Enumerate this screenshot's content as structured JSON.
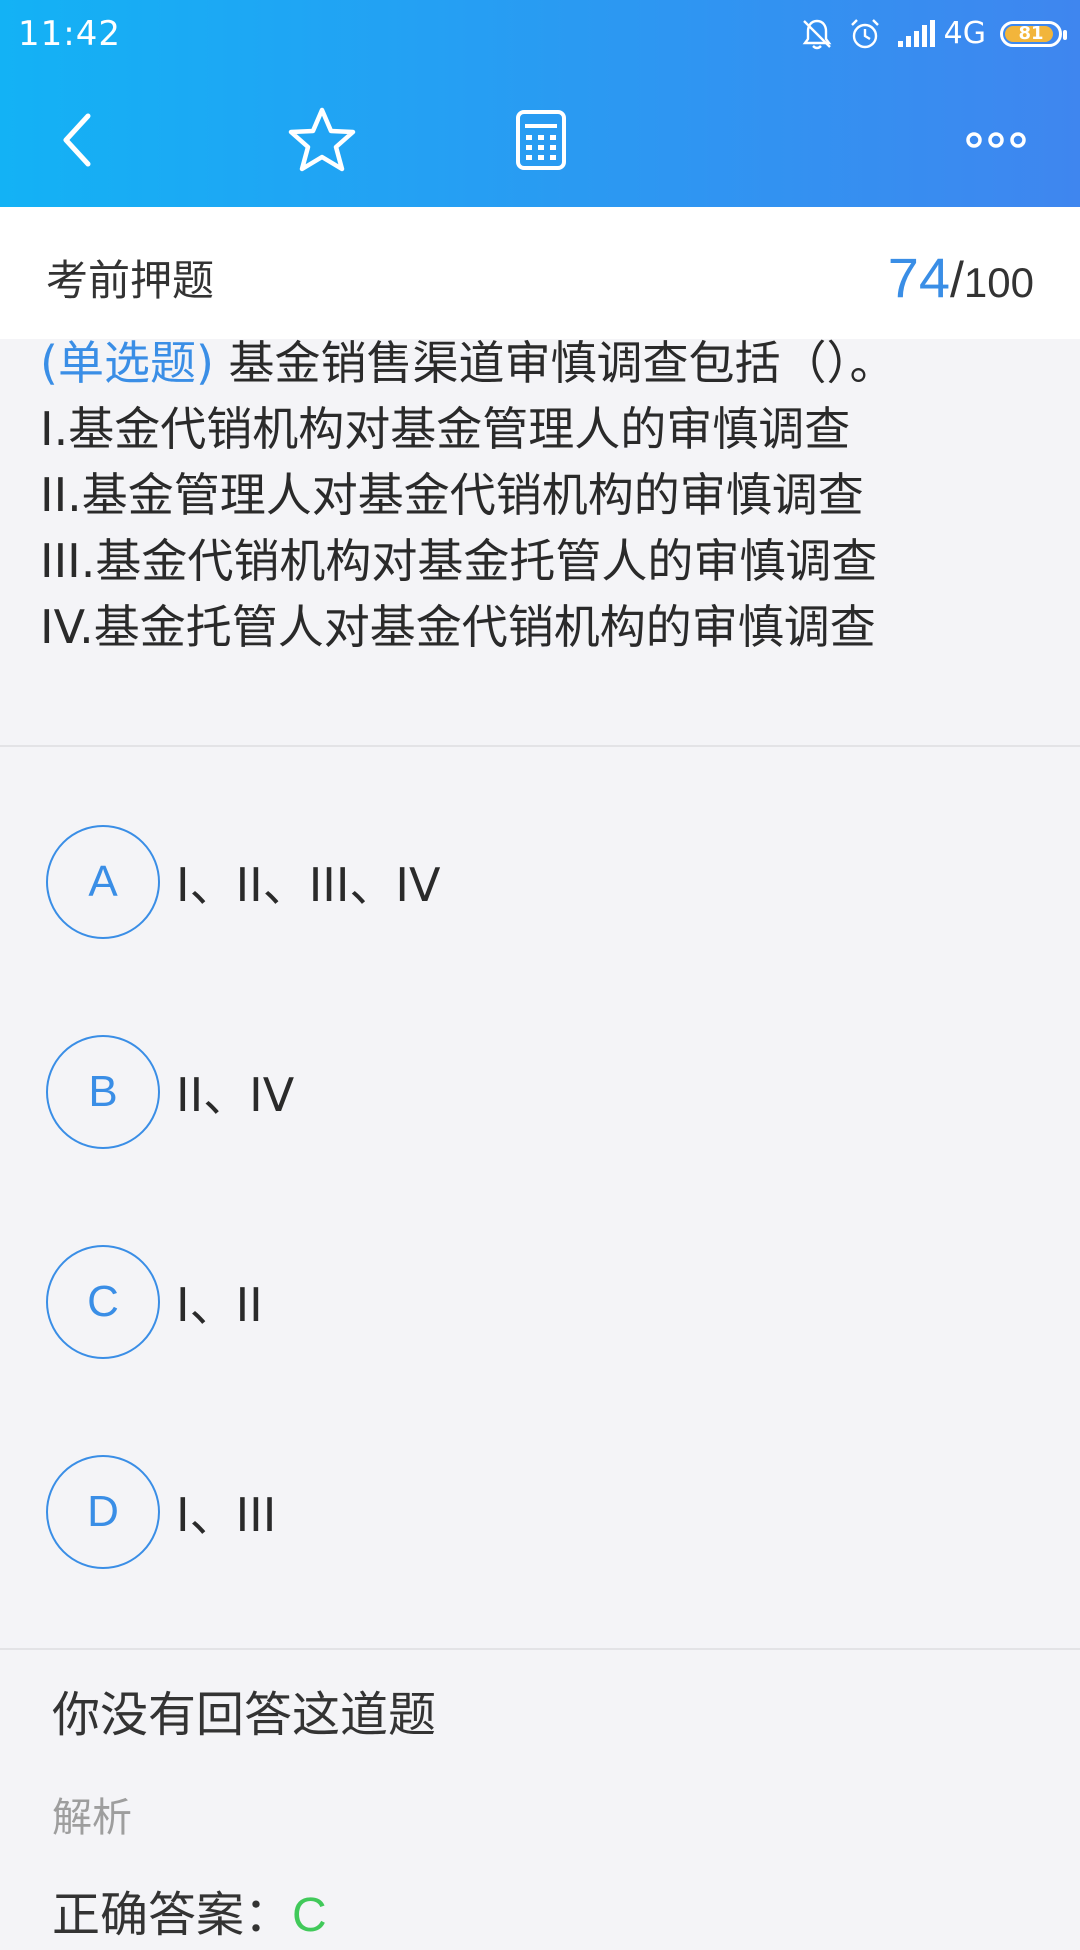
{
  "status_bar": {
    "time": "11:42",
    "network": "4G",
    "battery": "81",
    "icons": [
      "mute-bell-icon",
      "alarm-icon",
      "signal-icon",
      "battery-icon"
    ]
  },
  "toolbar": {
    "icons": [
      "back-icon",
      "star-icon",
      "calculator-icon",
      "more-icon"
    ],
    "color_start": "#13b2f5",
    "color_end": "#3f86ef"
  },
  "header": {
    "title": "考前押题",
    "current": "74",
    "separator": "/",
    "total": "100"
  },
  "question": {
    "type": "(单选题)",
    "stem": " 基金销售渠道审慎调查包括（）。",
    "items": [
      "I.基金代销机构对基金管理人的审慎调查",
      "II.基金管理人对基金代销机构的审慎调查",
      "III.基金代销机构对基金托管人的审慎调查",
      "IV.基金托管人对基金代销机构的审慎调查"
    ]
  },
  "options": [
    {
      "letter": "A",
      "text": "I、II、III、IV"
    },
    {
      "letter": "B",
      "text": "II、IV"
    },
    {
      "letter": "C",
      "text": "I、II"
    },
    {
      "letter": "D",
      "text": "I、III"
    }
  ],
  "result": {
    "message": "你没有回答这道题",
    "analysis_label": "解析",
    "answer_label": "正确答案：",
    "answer_value": "C"
  },
  "colors": {
    "accent": "#3a8ee6",
    "correct": "#41c95a",
    "battery": "#f2b53b"
  }
}
